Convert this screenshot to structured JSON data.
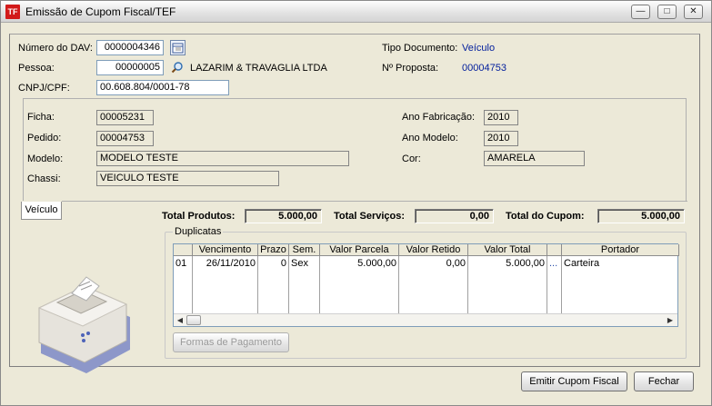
{
  "window": {
    "title": "Emissão de Cupom Fiscal/TEF",
    "icon_label": "TF",
    "controls": [
      "minimize",
      "maximize",
      "close"
    ]
  },
  "header": {
    "numero_dav_label": "Número do DAV:",
    "numero_dav_value": "0000004346",
    "pessoa_label": "Pessoa:",
    "pessoa_value": "00000005",
    "pessoa_name": "LAZARIM & TRAVAGLIA LTDA",
    "cnpj_label": "CNPJ/CPF:",
    "cnpj_value": "00.608.804/0001-78",
    "tipo_doc_label": "Tipo Documento:",
    "tipo_doc_value": "Veículo",
    "proposta_label": "Nº Proposta:",
    "proposta_value": "00004753"
  },
  "vehicle": {
    "ficha_label": "Ficha:",
    "ficha_value": "00005231",
    "pedido_label": "Pedido:",
    "pedido_value": "00004753",
    "modelo_label": "Modelo:",
    "modelo_value": "MODELO TESTE",
    "chassi_label": "Chassi:",
    "chassi_value": "VEICULO TESTE",
    "ano_fab_label": "Ano Fabricação:",
    "ano_fab_value": "2010",
    "ano_modelo_label": "Ano Modelo:",
    "ano_modelo_value": "2010",
    "cor_label": "Cor:",
    "cor_value": "AMARELA"
  },
  "tab": {
    "label": "Veículo"
  },
  "totals": {
    "produtos_label": "Total Produtos:",
    "produtos_value": "5.000,00",
    "servicos_label": "Total Serviços:",
    "servicos_value": "0,00",
    "cupom_label": "Total do Cupom:",
    "cupom_value": "5.000,00"
  },
  "duplicatas": {
    "title": "Duplicatas",
    "columns": [
      "",
      "Vencimento",
      "Prazo",
      "Sem.",
      "Valor Parcela",
      "Valor Retido",
      "Valor Total",
      "",
      "Portador"
    ],
    "rows": [
      {
        "num": "01",
        "vencimento": "26/11/2010",
        "prazo": "0",
        "sem": "Sex",
        "valor_parcela": "5.000,00",
        "valor_retido": "0,00",
        "valor_total": "5.000,00",
        "lookup": "...",
        "portador": "Carteira"
      }
    ],
    "formas_button": "Formas de Pagamento"
  },
  "footer": {
    "emitir_button": "Emitir Cupom Fiscal",
    "fechar_button": "Fechar"
  },
  "colors": {
    "accent_blue": "#001d9c",
    "window_bg": "#ece9d8",
    "app_icon_red": "#d21a1a"
  }
}
